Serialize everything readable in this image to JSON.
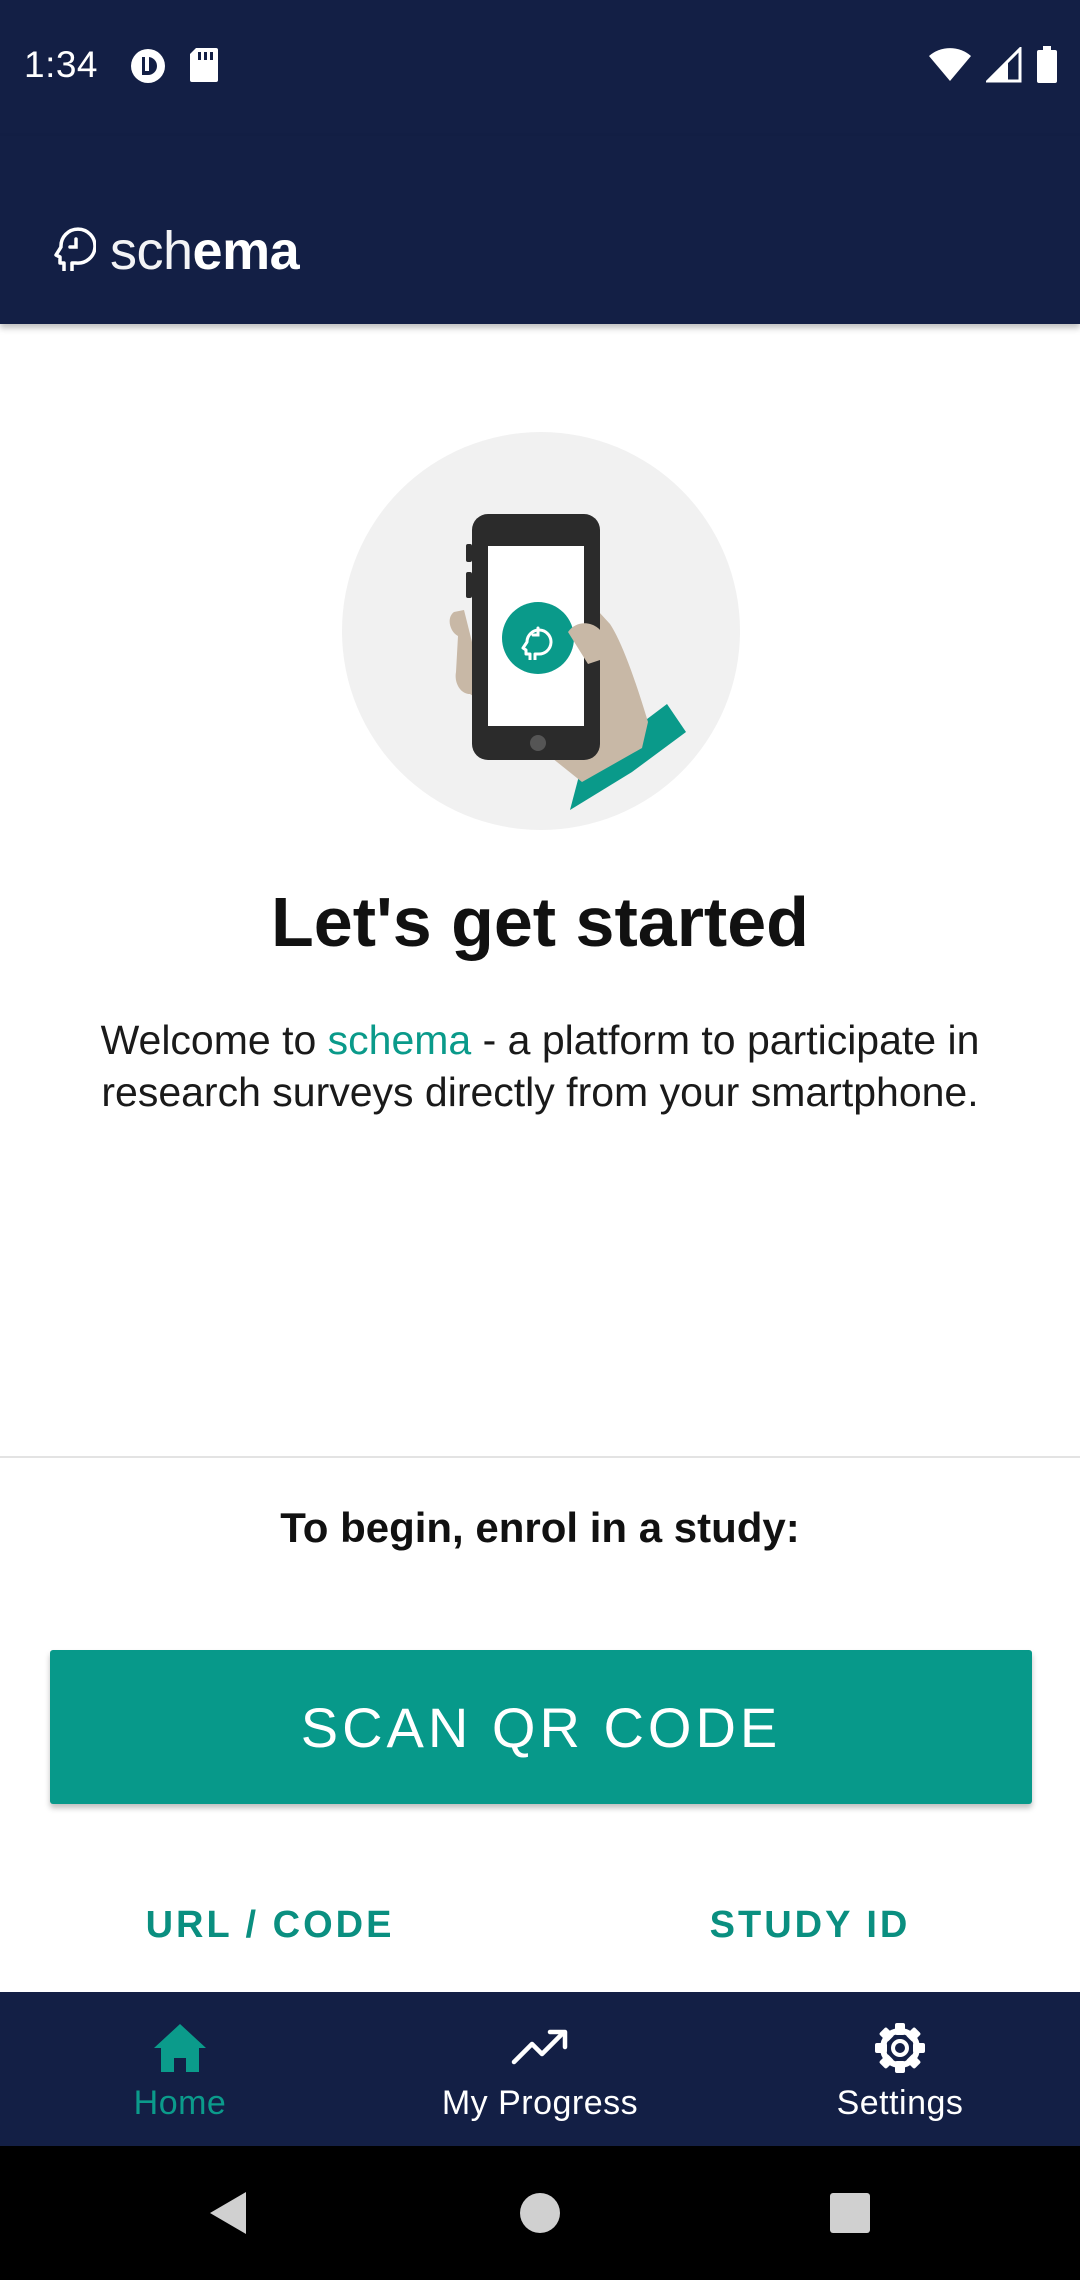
{
  "status_bar": {
    "time": "1:34",
    "left_icons": [
      "data-saver-icon",
      "sd-card-icon"
    ],
    "right_icons": [
      "wifi-icon",
      "signal-icon",
      "battery-icon"
    ]
  },
  "header": {
    "logo_icon": "schema-head-clock-icon",
    "logo_text_light": "sch",
    "logo_text_bold": "ema"
  },
  "hero": {
    "illustration": "hand-holding-phone-with-schema-logo",
    "headline": "Let's get started",
    "welcome_before": "Welcome to ",
    "welcome_brand": "schema",
    "welcome_after": " - a platform to participate in research surveys directly from your smartphone."
  },
  "enrol": {
    "prompt": "To begin, enrol in a study:",
    "scan_button": "SCAN QR CODE",
    "url_button": "URL / CODE",
    "study_id_button": "STUDY ID"
  },
  "bottom_nav": {
    "items": [
      {
        "label": "Home",
        "icon": "home-icon",
        "active": true
      },
      {
        "label": "My Progress",
        "icon": "trending-up-icon",
        "active": false
      },
      {
        "label": "Settings",
        "icon": "gear-icon",
        "active": false
      }
    ]
  },
  "system_nav": [
    "back-icon",
    "home-circle-icon",
    "recents-icon"
  ],
  "colors": {
    "primary_dark": "#131f45",
    "accent": "#07998a",
    "accent_text": "#0a8f80"
  }
}
